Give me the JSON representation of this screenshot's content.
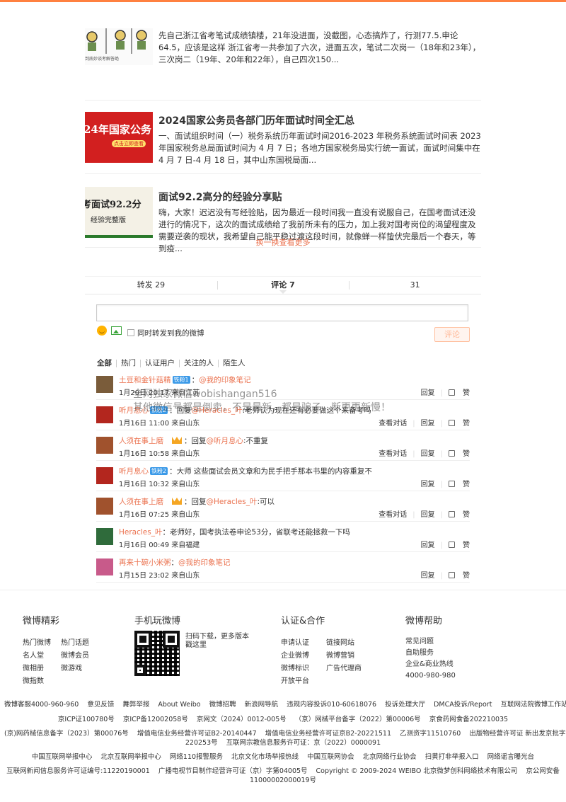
{
  "articles": [
    {
      "title": "",
      "desc": "先自己浙江省考笔试成绩镇楼，21年没进面，没截图，心态搞炸了，行测77.5.申论64.5，应该是这样 浙江省考一共参加了六次，进面五次，笔试二次岗一（18年和23年），三次岗二（19年、20年和22年），自己四次150...",
      "thumb_caption": "到底妙谈考解答绝"
    },
    {
      "title": "2024国家公务员各部门历年面试时间全汇总",
      "desc": "一、面试组织时间（一）税务系统历年面试时间2016-2023 年税务系统面试时间表 2023 年国家税务总局面试时间为 4 月 7 日；各地方国家税务局实行统一面试，面试时间集中在 4 月 7 日-4 月 18 日，其中山东国税局面...",
      "thumb_caption": "24年国家公务",
      "thumb_sub": "点击立即查看"
    },
    {
      "title": "面试92.2高分的经验分享贴",
      "desc": "嗨，大家！迟迟没有写经验贴，因为最近一段时间我一直没有说服自己，在国考面试还没进行的情况下，这次的面试成绩给了我前所未有的压力，加上我对国考岗位的渴望程度及需要逆袭的现状，我希望自己能平稳过渡这段时间，就像蝉一样蛰伏完最后一个春天，等到疫...",
      "thumb_caption": "考面试92.2分",
      "thumb_sub": "经验完整版"
    }
  ],
  "more_link": "换一换查看更多",
  "tabs": {
    "forward": "转发 29",
    "comment": "评论 7",
    "like": "31"
  },
  "composer": {
    "forward_label": "同时转发到我的微博",
    "submit": "评论"
  },
  "filters": [
    "全部",
    "热门",
    "认证用户",
    "关注的人",
    "陌生人"
  ],
  "comments": [
    {
      "nick": "土豆和金针菇精",
      "tag": "铁粉1",
      "crown": false,
      "text": "：",
      "at": "@我的印象笔记",
      "rest": "",
      "time": "1月20日 20:17 来自江苏",
      "dialog": ""
    },
    {
      "nick": "听月息心",
      "tag": "铁粉2",
      "crown": false,
      "text": "：回复",
      "at": "@Heracles_叶",
      "rest": ":老师认为现在还有必要做这个来备考吗",
      "time": "1月16日 11:00 来自山东",
      "dialog": "查看对话"
    },
    {
      "nick": "人须在事上磨",
      "tag": "",
      "crown": true,
      "text": "：回复",
      "at": "@听月息心",
      "rest": ":不重复",
      "time": "1月16日 10:58 来自山东",
      "dialog": "查看对话"
    },
    {
      "nick": "听月息心",
      "tag": "铁粉2",
      "crown": false,
      "text": "：大师 这些面试会员文章和为民手把手那本书里的内容重复不",
      "at": "",
      "rest": "",
      "time": "1月16日 10:32 来自山东",
      "dialog": ""
    },
    {
      "nick": "人须在事上磨",
      "tag": "",
      "crown": true,
      "text": "：回复",
      "at": "@Heracles_叶",
      "rest": ":可以",
      "time": "1月16日 07:25 来自山东",
      "dialog": "查看对话"
    },
    {
      "nick": "Heracles_叶",
      "tag": "",
      "crown": false,
      "text": "：老师好，国考执法卷申论53分，省联考还能拯救一下吗",
      "at": "",
      "rest": "",
      "time": "1月16日 00:49 来自福建",
      "dialog": ""
    },
    {
      "nick": "再来十碗小米粥",
      "tag": "",
      "crown": false,
      "text": "：",
      "at": "@我的印象笔记",
      "rest": "",
      "time": "1月15日 23:02 来自山东",
      "dialog": ""
    }
  ],
  "comment_actions": {
    "reply": "回复",
    "like": "赞"
  },
  "watermark": "全网独家微信wobishangan516\n其他微信号都是倒卖，不是最新，都是骗子，断更更新慢！",
  "footer": {
    "col1": {
      "title": "微博精彩",
      "links": [
        "热门微博",
        "热门话题",
        "名人堂",
        "微博会员",
        "微相册",
        "微游戏",
        "微指数"
      ]
    },
    "col2": {
      "title": "手机玩微博",
      "qr_text": "扫码下载，更多版本戳这里"
    },
    "col3": {
      "title": "认证&合作",
      "links": [
        "申请认证",
        "链接网站",
        "企业微博",
        "微博营销",
        "微博标识",
        "广告代理商",
        "开放平台"
      ]
    },
    "col4": {
      "title": "微博帮助",
      "links": [
        "常见问题",
        "自助服务",
        "企业&商业热线",
        "4000-980-980"
      ]
    }
  },
  "legal_lines": [
    [
      "微博客服4000-960-960",
      "意见反馈",
      "舞弊举报",
      "About Weibo",
      "微博招聘",
      "新浪网导航",
      "违规内容投诉010-60618076",
      "投诉处理大厅",
      "DMCA投诉/Report",
      "互联网法院微博工作站"
    ],
    [
      "京ICP证100780号",
      "京ICP备12002058号",
      "京网文（2024）0012-005号",
      "（京）网械平台备字（2022）第00006号",
      "京食药网食备202210035"
    ],
    [
      "(京)网药械信息备字（2023）第00076号",
      "增值电信业务经营许可证B2-20140447",
      "增值电信业务经营许可证京B2-20221511",
      "乙测资字11510760",
      "出版物经营许可证 新出发京批字第直"
    ],
    [
      "220253号",
      "互联网宗教信息服务许可证：京（2022）0000091"
    ],
    [
      "中国互联网举报中心",
      "北京互联网举报中心",
      "网络110报警服务",
      "北京文化市场举报热线",
      "中国互联网协会",
      "北京网络行业协会",
      "扫黄打非举报入口",
      "网络谣言曝光台"
    ],
    [
      "互联网新闻信息服务许可证编号:11220190001",
      "广播电视节目制作经营许可证（京）字第04005号",
      "Copyright © 2009-2024 WEIBO 北京微梦创科网络技术有限公司",
      "京公网安备"
    ],
    [
      "11000002000019号"
    ]
  ]
}
